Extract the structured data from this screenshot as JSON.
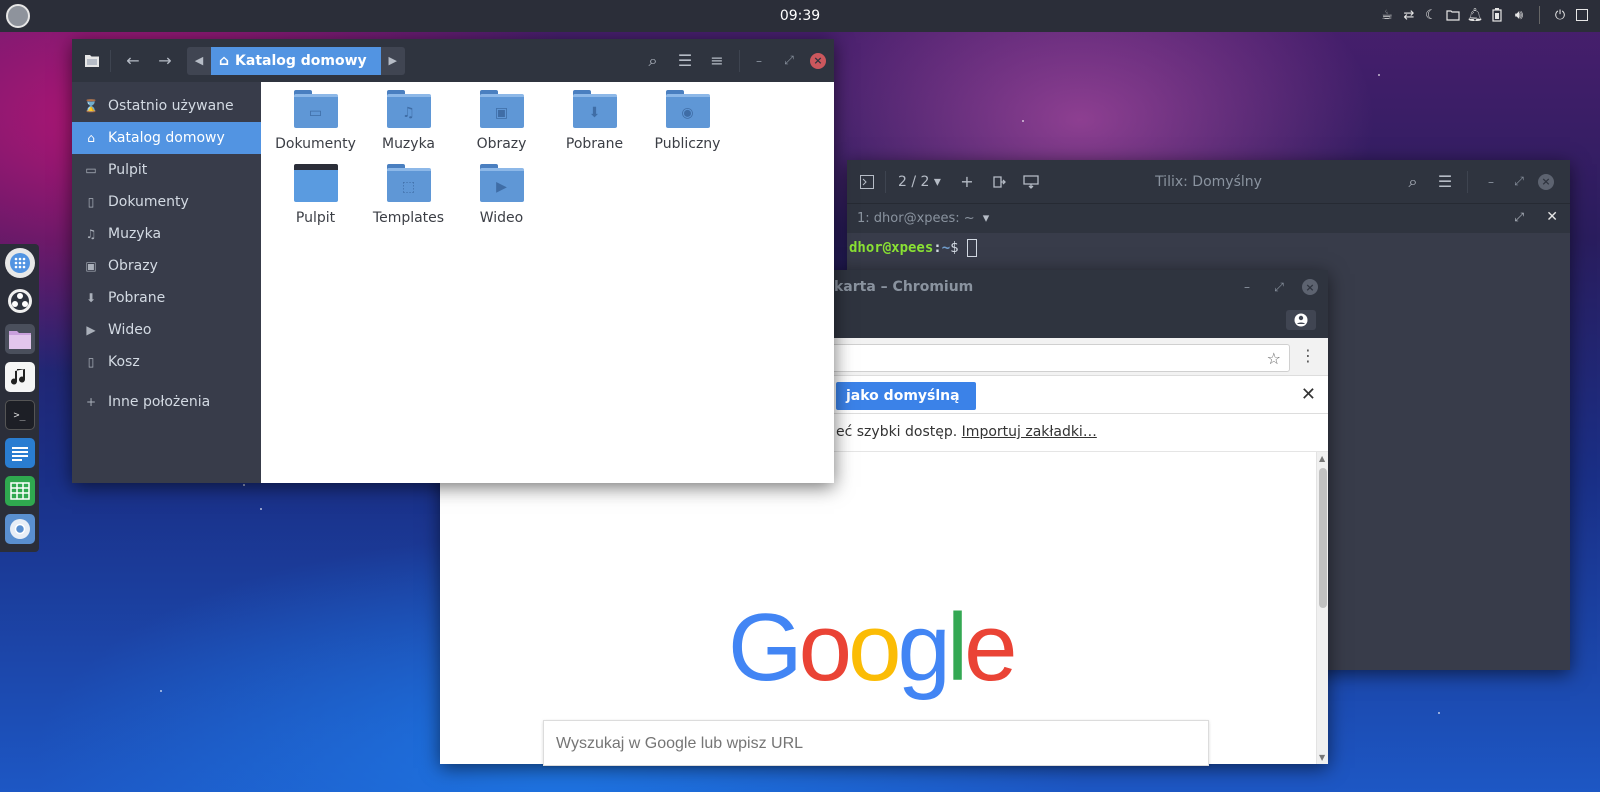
{
  "top_panel": {
    "clock": "09:39",
    "tray_icons": [
      "coffee-icon",
      "transfer-icon",
      "night-mode-icon",
      "folder-icon",
      "notification-icon",
      "battery-icon",
      "volume-icon",
      "power-icon"
    ]
  },
  "dock": {
    "items": [
      "apps-grid-icon",
      "system-icon",
      "files-icon",
      "music-icon",
      "terminal-icon",
      "writer-icon",
      "calc-icon",
      "chromium-icon"
    ]
  },
  "files": {
    "path_current": "Katalog domowy",
    "sidebar": [
      {
        "label": "Ostatnio używane",
        "icon": "clock-icon"
      },
      {
        "label": "Katalog domowy",
        "icon": "home-icon",
        "active": true
      },
      {
        "label": "Pulpit",
        "icon": "desktop-icon"
      },
      {
        "label": "Dokumenty",
        "icon": "document-icon"
      },
      {
        "label": "Muzyka",
        "icon": "music-icon"
      },
      {
        "label": "Obrazy",
        "icon": "image-icon"
      },
      {
        "label": "Pobrane",
        "icon": "download-icon"
      },
      {
        "label": "Wideo",
        "icon": "video-icon"
      },
      {
        "label": "Kosz",
        "icon": "trash-icon"
      },
      {
        "label": "Inne położenia",
        "icon": "plus-icon"
      }
    ],
    "items": [
      {
        "label": "Dokumenty",
        "glyph": "▭"
      },
      {
        "label": "Muzyka",
        "glyph": "♫"
      },
      {
        "label": "Obrazy",
        "glyph": "▣"
      },
      {
        "label": "Pobrane",
        "glyph": "⬇"
      },
      {
        "label": "Publiczny",
        "glyph": "◉"
      },
      {
        "label": "Pulpit",
        "glyph": ""
      },
      {
        "label": "Templates",
        "glyph": "⬚"
      },
      {
        "label": "Wideo",
        "glyph": "▶"
      }
    ]
  },
  "terminal": {
    "title": "Tilix: Domyślny",
    "session_counter": "2 / 2",
    "session_name": "1: dhor@xpees: ~",
    "prompt_user": "dhor@xpees",
    "prompt_colon": ":",
    "prompt_path": "~",
    "prompt_symbol": "$"
  },
  "chromium": {
    "title": "karta – Chromium",
    "infobar_button": "jako domyślną",
    "bookmark_text": "eć szybki dostęp.",
    "bookmark_link": "Importuj zakładki…",
    "search_placeholder": "Wyszukaj w Google lub wpisz URL",
    "logo": {
      "G": "G",
      "o1": "o",
      "o2": "o",
      "g": "g",
      "l": "l",
      "e": "e"
    }
  },
  "colors": {
    "accent": "#5294e2",
    "panel": "#2b2e39",
    "titlebar": "#2f343f",
    "close": "#cc575d"
  }
}
